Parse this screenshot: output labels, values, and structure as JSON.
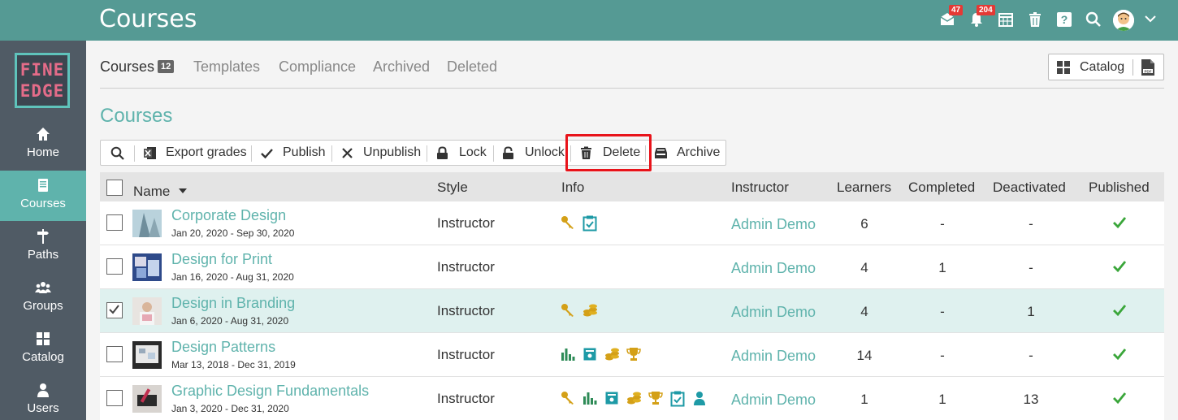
{
  "header": {
    "title": "Courses",
    "messages_badge": "47",
    "notifications_badge": "204"
  },
  "sidebar": {
    "logo_line1": "FINE",
    "logo_line2": "EDGE",
    "items": [
      {
        "label": "Home",
        "icon": "home-icon"
      },
      {
        "label": "Courses",
        "icon": "book-icon"
      },
      {
        "label": "Paths",
        "icon": "signpost-icon"
      },
      {
        "label": "Groups",
        "icon": "groups-icon"
      },
      {
        "label": "Catalog",
        "icon": "grid-icon"
      },
      {
        "label": "Users",
        "icon": "user-icon"
      }
    ]
  },
  "tabs": {
    "courses_label": "Courses",
    "courses_count": "12",
    "templates": "Templates",
    "compliance": "Compliance",
    "archived": "Archived",
    "deleted": "Deleted"
  },
  "catalog_button": {
    "label": "Catalog"
  },
  "section_title": "Courses",
  "toolbar": {
    "export": "Export grades",
    "publish": "Publish",
    "unpublish": "Unpublish",
    "lock": "Lock",
    "unlock": "Unlock",
    "delete": "Delete",
    "archive": "Archive"
  },
  "table": {
    "headers": {
      "name": "Name",
      "style": "Style",
      "info": "Info",
      "instructor": "Instructor",
      "learners": "Learners",
      "completed": "Completed",
      "deactivated": "Deactivated",
      "published": "Published"
    },
    "rows": [
      {
        "name": "Corporate Design",
        "dates": "Jan 20, 2020 - Sep 30, 2020",
        "style": "Instructor",
        "instructor": "Admin Demo",
        "learners": "6",
        "completed": "-",
        "deactivated": "-",
        "selected": false
      },
      {
        "name": "Design for Print",
        "dates": "Jan 16, 2020 - Aug 31, 2020",
        "style": "Instructor",
        "instructor": "Admin Demo",
        "learners": "4",
        "completed": "1",
        "deactivated": "-",
        "selected": false
      },
      {
        "name": "Design in Branding",
        "dates": "Jan 6, 2020 - Aug 31, 2020",
        "style": "Instructor",
        "instructor": "Admin Demo",
        "learners": "4",
        "completed": "-",
        "deactivated": "1",
        "selected": true
      },
      {
        "name": "Design Patterns",
        "dates": "Mar 13, 2018 - Dec 31, 2019",
        "style": "Instructor",
        "instructor": "Admin Demo",
        "learners": "14",
        "completed": "-",
        "deactivated": "-",
        "selected": false
      },
      {
        "name": "Graphic Design Fundamentals",
        "dates": "Jan 3, 2020 - Dec 31, 2020",
        "style": "Instructor",
        "instructor": "Admin Demo",
        "learners": "1",
        "completed": "1",
        "deactivated": "13",
        "selected": false
      }
    ]
  },
  "colors": {
    "header": "#559a94",
    "accent": "#5fb3ac",
    "sidebar": "#505b65",
    "gold": "#d4a017",
    "green_check": "#3aa63a",
    "highlight": "#e8131a"
  }
}
